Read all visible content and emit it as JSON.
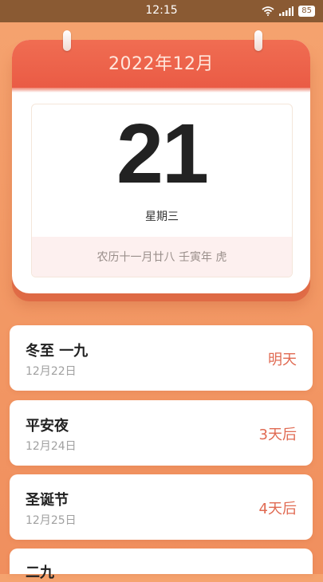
{
  "status_bar": {
    "time": "12:15",
    "battery": "85",
    "icons": [
      "wifi-icon",
      "signal-icon",
      "battery-icon"
    ]
  },
  "calendar": {
    "title": "2022年12月",
    "day": "21",
    "weekday": "星期三",
    "lunar": "农历十一月廿八 壬寅年 虎"
  },
  "events": [
    {
      "name": "冬至 一九",
      "date": "12月22日",
      "relative": "明天"
    },
    {
      "name": "平安夜",
      "date": "12月24日",
      "relative": "3天后"
    },
    {
      "name": "圣诞节",
      "date": "12月25日",
      "relative": "4天后"
    },
    {
      "name": "二九",
      "date": "",
      "relative": ""
    }
  ],
  "colors": {
    "background": "#f39a66",
    "header": "#ea5b45",
    "accent": "#e06a52"
  }
}
